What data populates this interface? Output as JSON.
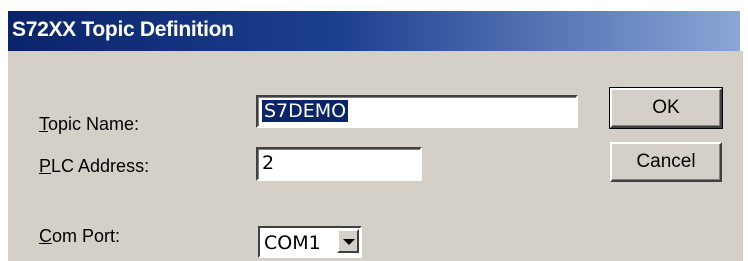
{
  "window": {
    "title": "S72XX Topic Definition"
  },
  "form": {
    "topic_name": {
      "mnemonic": "T",
      "label_rest": "opic Name:",
      "value": "S7DEMO"
    },
    "plc_address": {
      "mnemonic": "P",
      "label_rest": "LC Address:",
      "value": "2"
    },
    "com_port": {
      "mnemonic": "C",
      "label_rest": "om Port:",
      "value": "COM1"
    }
  },
  "buttons": {
    "ok": "OK",
    "cancel": "Cancel"
  },
  "icons": {
    "dropdown": "chevron-down-icon"
  },
  "colors": {
    "titlebar_start": "#0a246a",
    "titlebar_end": "#8aa6d6",
    "dialog_face": "#d4d0c8",
    "selection": "#0a246a"
  }
}
